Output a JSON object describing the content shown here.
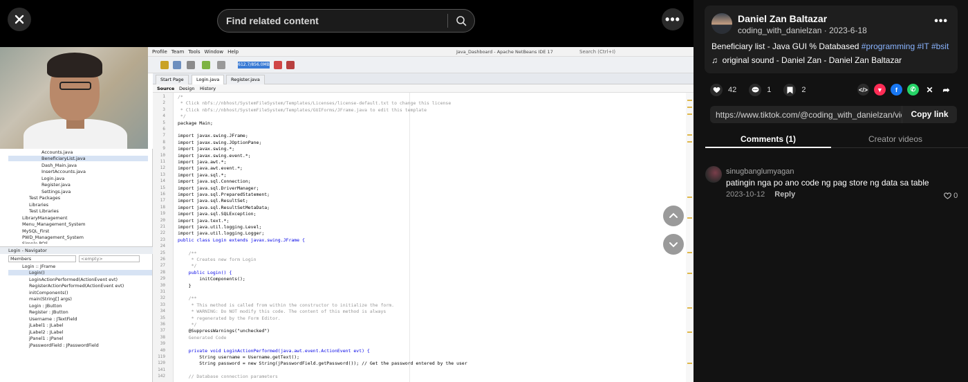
{
  "top_bar": {
    "search_placeholder": "Find related content"
  },
  "video_screen": {
    "menu": [
      "Profile",
      "Team",
      "Tools",
      "Window",
      "Help"
    ],
    "window_title": "Java_Dashboard - Apache NetBeans IDE 17",
    "memory": "612.7/856.0MB",
    "search_hint": "Search (Ctrl+I)",
    "editor_tabs": [
      "Start Page",
      "Login.java",
      "Register.java"
    ],
    "source_tabs": [
      "Source",
      "Design",
      "History"
    ],
    "project_tree": [
      "Accounts.java",
      "BeneficiaryList.java",
      "Dash_Main.java",
      "InsertAccounts.java",
      "Login.java",
      "Register.java",
      "Settings.java",
      "Test Packages",
      "Libraries",
      "Test Libraries",
      "LibraryManagement",
      "Menu_Management_System",
      "MySQL_First",
      "PWD_Management_System",
      "Simple POS"
    ],
    "navigator_title": "Login - Navigator",
    "navigator_filter": "Members",
    "navigator_empty": "<empty>",
    "navigator_items": [
      "Login :: JFrame",
      "Login()",
      "LoginActionPerformed(ActionEvent evt)",
      "RegisterActionPerformed(ActionEvent evt)",
      "initComponents()",
      "main(String[] args)",
      "Login : JButton",
      "Register : JButton",
      "Username : JTextField",
      "jLabel1 : JLabel",
      "jLabel2 : JLabel",
      "jPanel1 : JPanel",
      "jPasswordField : JPasswordField"
    ],
    "code_lines": [
      {
        "n": "1",
        "t": "/*",
        "c": "cm"
      },
      {
        "n": "2",
        "t": " * Click nbfs://nbhost/SystemFileSystem/Templates/Licenses/license-default.txt to change this license",
        "c": "cm"
      },
      {
        "n": "3",
        "t": " * Click nbfs://nbhost/SystemFileSystem/Templates/GUIForms/JFrame.java to edit this template",
        "c": "cm"
      },
      {
        "n": "4",
        "t": " */",
        "c": "cm"
      },
      {
        "n": "5",
        "t": "package Main;",
        "c": ""
      },
      {
        "n": "6",
        "t": "",
        "c": ""
      },
      {
        "n": "7",
        "t": "import javax.swing.JFrame;",
        "c": ""
      },
      {
        "n": "8",
        "t": "import javax.swing.JOptionPane;",
        "c": ""
      },
      {
        "n": "9",
        "t": "import javax.swing.*;",
        "c": ""
      },
      {
        "n": "10",
        "t": "import javax.swing.event.*;",
        "c": ""
      },
      {
        "n": "11",
        "t": "import java.awt.*;",
        "c": ""
      },
      {
        "n": "12",
        "t": "import java.awt.event.*;",
        "c": ""
      },
      {
        "n": "13",
        "t": "import java.sql.*;",
        "c": ""
      },
      {
        "n": "14",
        "t": "import java.sql.Connection;",
        "c": ""
      },
      {
        "n": "15",
        "t": "import java.sql.DriverManager;",
        "c": ""
      },
      {
        "n": "16",
        "t": "import java.sql.PreparedStatement;",
        "c": ""
      },
      {
        "n": "17",
        "t": "import java.sql.ResultSet;",
        "c": ""
      },
      {
        "n": "18",
        "t": "import java.sql.ResultSetMetaData;",
        "c": ""
      },
      {
        "n": "19",
        "t": "import java.sql.SQLException;",
        "c": ""
      },
      {
        "n": "20",
        "t": "import java.text.*;",
        "c": ""
      },
      {
        "n": "21",
        "t": "import java.util.logging.Level;",
        "c": ""
      },
      {
        "n": "22",
        "t": "import java.util.logging.Logger;",
        "c": ""
      },
      {
        "n": "23",
        "t": "public class Login extends javax.swing.JFrame {",
        "c": "kw"
      },
      {
        "n": "24",
        "t": "",
        "c": ""
      },
      {
        "n": "25",
        "t": "    /**",
        "c": "cm"
      },
      {
        "n": "26",
        "t": "     * Creates new form Login",
        "c": "cm"
      },
      {
        "n": "27",
        "t": "     */",
        "c": "cm"
      },
      {
        "n": "28",
        "t": "    public Login() {",
        "c": "kw"
      },
      {
        "n": "29",
        "t": "        initComponents();",
        "c": ""
      },
      {
        "n": "30",
        "t": "    }",
        "c": ""
      },
      {
        "n": "31",
        "t": "",
        "c": ""
      },
      {
        "n": "32",
        "t": "    /**",
        "c": "cm"
      },
      {
        "n": "33",
        "t": "     * This method is called from within the constructor to initialize the form.",
        "c": "cm"
      },
      {
        "n": "34",
        "t": "     * WARNING: Do NOT modify this code. The content of this method is always",
        "c": "cm"
      },
      {
        "n": "35",
        "t": "     * regenerated by the Form Editor.",
        "c": "cm"
      },
      {
        "n": "36",
        "t": "     */",
        "c": "cm"
      },
      {
        "n": "37",
        "t": "    @SuppressWarnings(\"unchecked\")",
        "c": ""
      },
      {
        "n": "38",
        "t": "    Generated Code",
        "c": "cm"
      },
      {
        "n": "39",
        "t": "",
        "c": ""
      },
      {
        "n": "40",
        "t": "    private void LoginActionPerformed(java.awt.event.ActionEvent evt) {",
        "c": "kw"
      },
      {
        "n": "119",
        "t": "        String username = Username.getText();",
        "c": ""
      },
      {
        "n": "120",
        "t": "        String password = new String(jPasswordField.getPassword()); // Get the password entered by the user",
        "c": ""
      },
      {
        "n": "141",
        "t": "",
        "c": ""
      },
      {
        "n": "142",
        "t": "    // Database connection parameters",
        "c": "cm"
      }
    ]
  },
  "post": {
    "author_name": "Daniel Zan Baltazar",
    "author_handle": "coding_with_danielzan",
    "separator": " · ",
    "date": "2023-6-18",
    "description": "Beneficiary list - Java GUI % Databased ",
    "tags": [
      "#programming",
      "#IT",
      "#bsit"
    ],
    "sound": "original sound - Daniel Zan - Daniel Zan Baltazar",
    "likes": "42",
    "comments": "1",
    "saves": "2",
    "link": "https://www.tiktok.com/@coding_with_danielzan/video...",
    "copy_label": "Copy link"
  },
  "tabs": {
    "comments": "Comments (1)",
    "creator_videos": "Creator videos"
  },
  "comment": {
    "user": "sinugbanglumyagan",
    "text": "patingin nga po ano code ng pag store ng data sa table",
    "date": "2023-10-12",
    "reply": "Reply",
    "likes": "0"
  },
  "colors": {
    "background": "#121212",
    "accent_tag": "#8ab4ff",
    "ide_keyword": "#0000e6"
  }
}
